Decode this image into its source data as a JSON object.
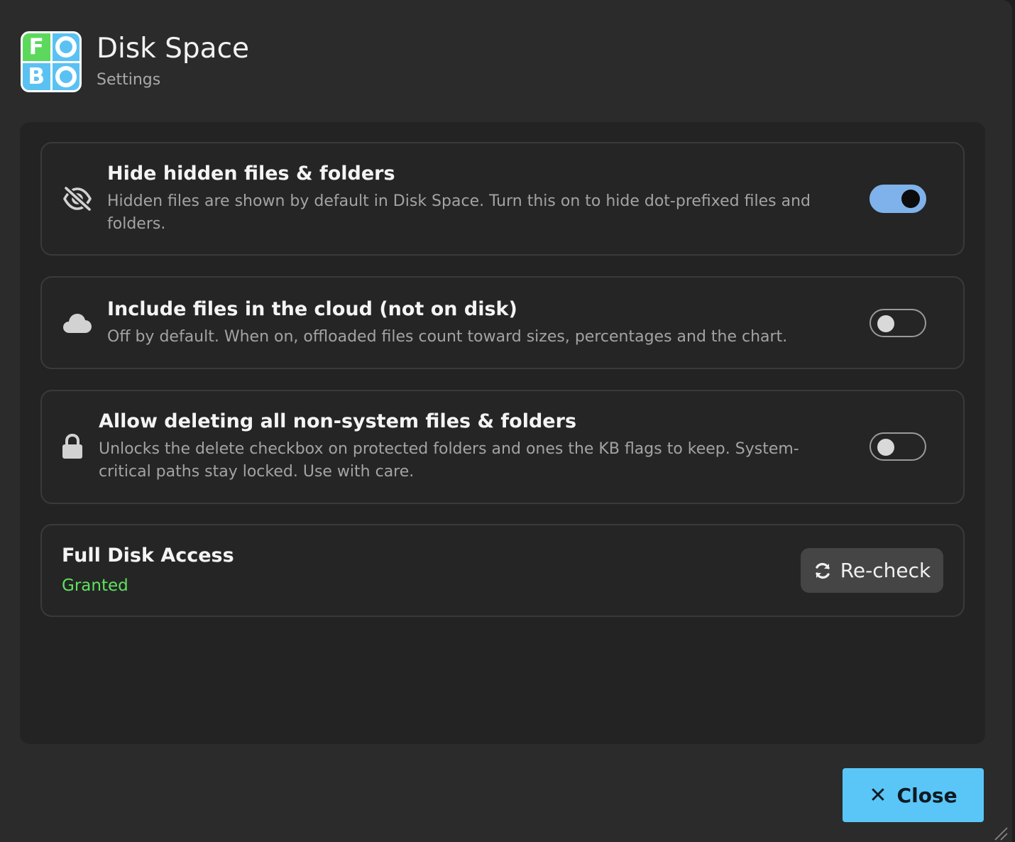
{
  "header": {
    "logo_letters": [
      "F",
      "B"
    ],
    "title": "Disk Space",
    "subtitle": "Settings"
  },
  "settings": [
    {
      "icon": "eye-slash-icon",
      "title": "Hide hidden files & folders",
      "description": "Hidden files are shown by default in Disk Space. Turn this on to hide dot-prefixed files and folders.",
      "enabled": true
    },
    {
      "icon": "cloud-icon",
      "title": "Include files in the cloud (not on disk)",
      "description": "Off by default. When on, offloaded files count toward sizes, percentages and the chart.",
      "enabled": false
    },
    {
      "icon": "lock-icon",
      "title": "Allow deleting all non-system files & folders",
      "description": "Unlocks the delete checkbox on protected folders and ones the KB flags to keep. System-critical paths stay locked. Use with care.",
      "enabled": false
    }
  ],
  "full_disk_access": {
    "title": "Full Disk Access",
    "status": "Granted",
    "recheck_label": "Re-check"
  },
  "footer": {
    "close_label": "Close"
  },
  "colors": {
    "accent": "#5ac6f7",
    "toggle_on": "#7fb2ea",
    "granted": "#5fe25f"
  }
}
